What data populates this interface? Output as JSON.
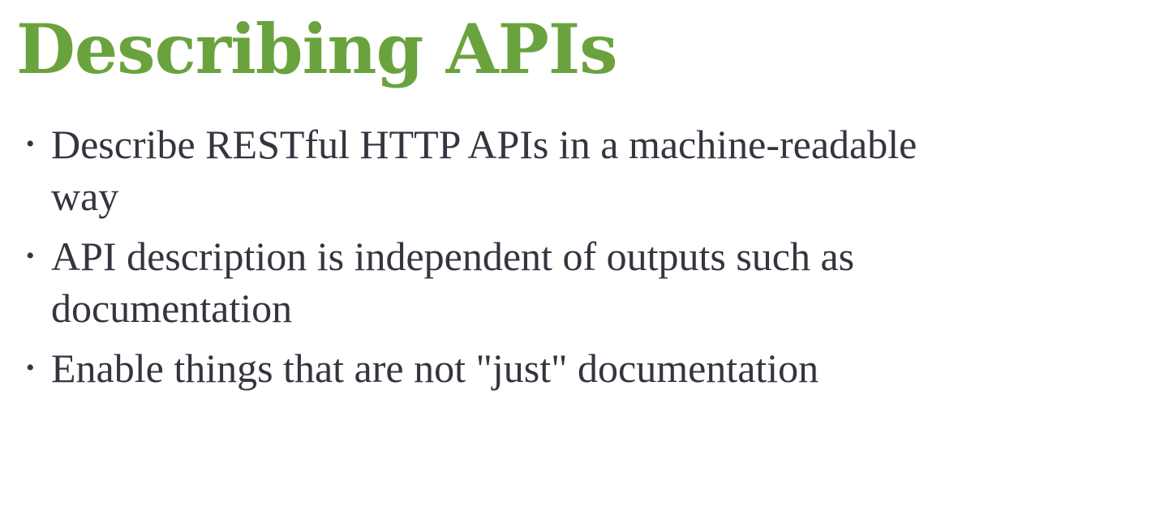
{
  "slide": {
    "title": "Describing APIs",
    "bullet_glyph": "•",
    "bullets": [
      {
        "text": "Describe RESTful HTTP APIs in a machine-readable way"
      },
      {
        "text": "API description is independent of outputs such as documentation"
      },
      {
        "text": "Enable things that are not \"just\" documentation"
      }
    ],
    "colors": {
      "title": "#6aa33e",
      "body_text": "#36343f",
      "background": "#ffffff"
    }
  }
}
